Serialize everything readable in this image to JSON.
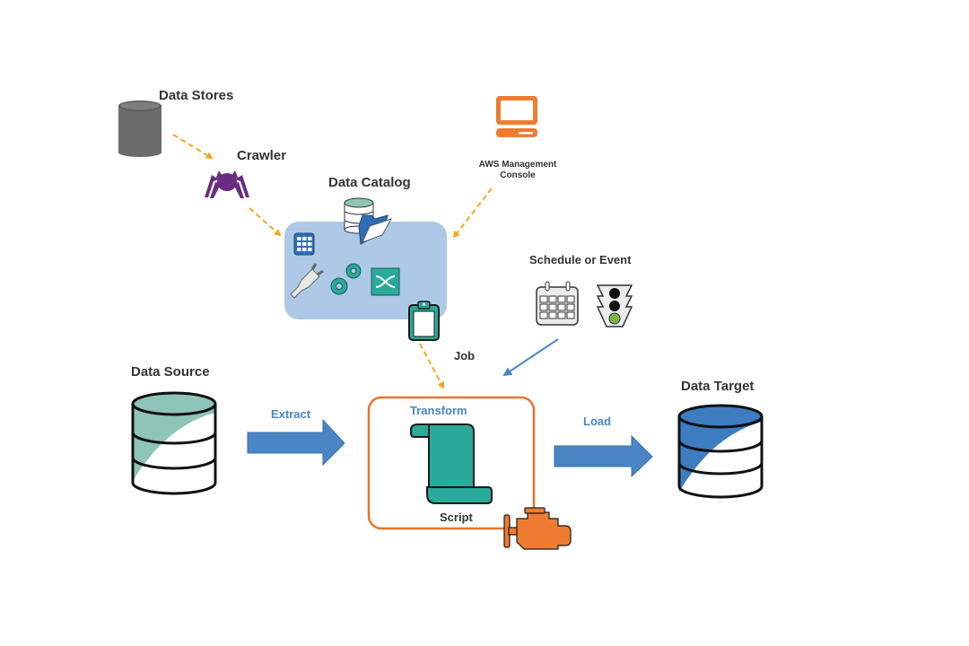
{
  "diagram": {
    "labels": {
      "data_stores": "Data Stores",
      "crawler": "Crawler",
      "data_catalog": "Data Catalog",
      "aws_console_line1": "AWS Management",
      "aws_console_line2": "Console",
      "schedule_or_event": "Schedule or Event",
      "job": "Job",
      "data_source": "Data Source",
      "extract": "Extract",
      "transform": "Transform",
      "script": "Script",
      "load": "Load",
      "data_target": "Data Target"
    },
    "colors": {
      "dashed_arrow": "#f5a623",
      "flow_arrow": "#4a86c5",
      "catalog_box": "#adc9e6",
      "transform_border": "#e8732a",
      "teal": "#2aaa9a",
      "source_fill": "#8fc4b8",
      "target_fill": "#3d7cc1",
      "console": "#ee7b30",
      "crawler": "#6a2c82",
      "datastore": "#6b6b6b"
    },
    "connections": [
      {
        "from": "data-stores",
        "to": "crawler",
        "style": "dashed"
      },
      {
        "from": "crawler",
        "to": "data-catalog",
        "style": "dashed"
      },
      {
        "from": "aws-management-console",
        "to": "data-catalog",
        "style": "dashed"
      },
      {
        "from": "data-catalog",
        "to": "transform",
        "style": "dashed"
      },
      {
        "from": "schedule-or-event",
        "to": "transform",
        "style": "solid"
      },
      {
        "from": "data-source",
        "to": "transform",
        "label": "Extract"
      },
      {
        "from": "transform",
        "to": "data-target",
        "label": "Load"
      }
    ]
  }
}
